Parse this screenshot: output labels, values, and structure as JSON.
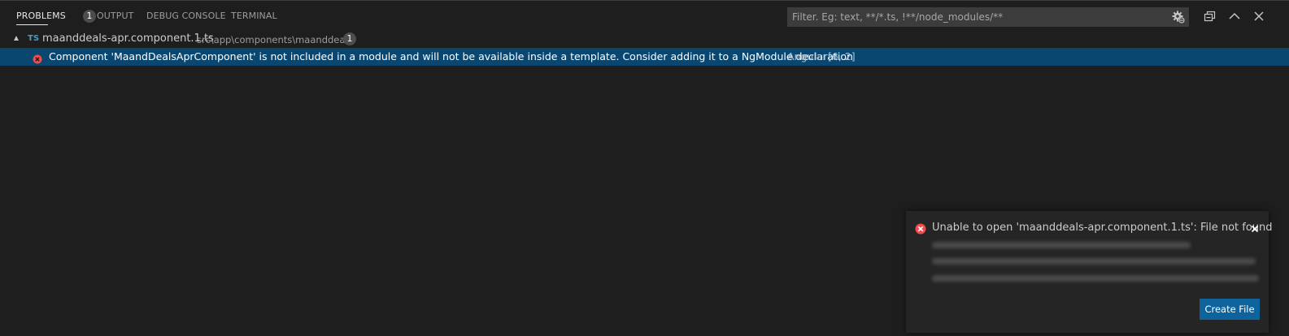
{
  "tabs": [
    {
      "label": "PROBLEMS",
      "active": true,
      "badge": "1"
    },
    {
      "label": "OUTPUT",
      "active": false
    },
    {
      "label": "DEBUG CONSOLE",
      "active": false
    },
    {
      "label": "TERMINAL",
      "active": false
    }
  ],
  "filter": {
    "placeholder": "Filter. Eg: text, **/*.ts, !**/node_modules/**",
    "value": ""
  },
  "actions": [
    "filter-settings-icon",
    "collapse-all-icon",
    "maximize-panel-icon",
    "close-panel-icon"
  ],
  "file": {
    "icon_label": "TS",
    "name": "maanddeals-apr.component.1.ts",
    "path": "src\\app\\components\\maanddeals",
    "count": "1"
  },
  "problem": {
    "severity": "error",
    "message": "Component 'MaandDealsAprComponent' is not included in a module and will not be available inside a template. Consider adding it to a NgModule declaration",
    "source": "Angular",
    "position": "[6, 2]"
  },
  "notification": {
    "severity": "error",
    "message": "Unable to open 'maanddeals-apr.component.1.ts': File not found",
    "button_label": "Create File"
  },
  "colors": {
    "background": "#1e1e1e",
    "selection": "#094771",
    "error": "#f14c4c",
    "ts_icon": "#519aba",
    "button": "#0e639c"
  }
}
